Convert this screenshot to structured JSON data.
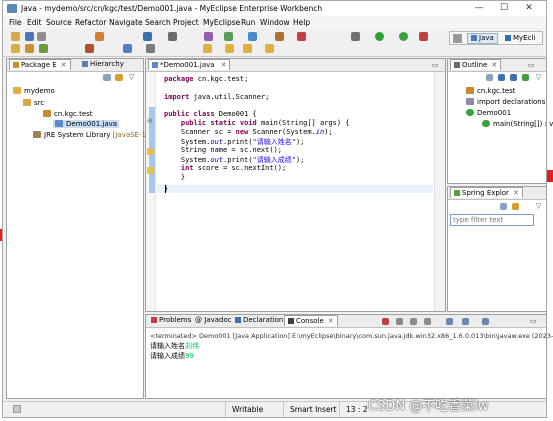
{
  "window": {
    "title": "Java - mydemo/src/cn/kgc/test/Demo001.java - MyEclipse Enterprise Workbench",
    "controls": [
      "—",
      "☐",
      "✕"
    ]
  },
  "menu": [
    "File",
    "Edit",
    "Source",
    "Refactor",
    "Navigate",
    "Search",
    "Project",
    "MyEclipse",
    "Run",
    "Window",
    "Help"
  ],
  "perspectives": {
    "java": "Java",
    "myeclipse": "MyEcli"
  },
  "package_explorer": {
    "tabs": [
      "Package E",
      "Hierarchy"
    ],
    "tree": [
      {
        "label": "mydemo",
        "level": 0,
        "icon": "project-icon"
      },
      {
        "label": "src",
        "level": 1,
        "icon": "folder-icon"
      },
      {
        "label": "cn.kgc.test",
        "level": 2,
        "icon": "package-icon"
      },
      {
        "label": "Demo001.java",
        "level": 3,
        "icon": "java-file-icon"
      }
    ],
    "jre": {
      "name": "JRE System Library",
      "version": "[JavaSE-1.6]"
    }
  },
  "editor": {
    "tab": "*Demo001.java",
    "lines": [
      [
        {
          "t": "package",
          "c": "kw"
        },
        {
          "t": " cn.kgc.test;",
          "c": ""
        }
      ],
      [],
      [
        {
          "t": "import",
          "c": "kw"
        },
        {
          "t": " java.util.Scanner;",
          "c": ""
        }
      ],
      [],
      [
        {
          "t": "public",
          "c": "kw"
        },
        {
          "t": " ",
          "c": ""
        },
        {
          "t": "class",
          "c": "kw"
        },
        {
          "t": " Demo001 {",
          "c": ""
        }
      ],
      [
        {
          "t": "    ",
          "c": ""
        },
        {
          "t": "public",
          "c": "kw"
        },
        {
          "t": " ",
          "c": ""
        },
        {
          "t": "static",
          "c": "kw"
        },
        {
          "t": " ",
          "c": ""
        },
        {
          "t": "void",
          "c": "kw"
        },
        {
          "t": " main(String[] args) {",
          "c": ""
        }
      ],
      [
        {
          "t": "    Scanner sc = ",
          "c": ""
        },
        {
          "t": "new",
          "c": "kw"
        },
        {
          "t": " Scanner(System.",
          "c": ""
        },
        {
          "t": "in",
          "c": "fld"
        },
        {
          "t": ");",
          "c": ""
        }
      ],
      [
        {
          "t": "    System.",
          "c": ""
        },
        {
          "t": "out",
          "c": "fld"
        },
        {
          "t": ".print(",
          "c": ""
        },
        {
          "t": "\"请输入姓名\"",
          "c": "str"
        },
        {
          "t": ");",
          "c": ""
        }
      ],
      [
        {
          "t": "    String name = sc.next();",
          "c": ""
        }
      ],
      [
        {
          "t": "    System.",
          "c": ""
        },
        {
          "t": "out",
          "c": "fld"
        },
        {
          "t": ".print(",
          "c": ""
        },
        {
          "t": "\"请输入成绩\"",
          "c": "str"
        },
        {
          "t": ");",
          "c": ""
        }
      ],
      [
        {
          "t": "    ",
          "c": ""
        },
        {
          "t": "int",
          "c": "kw"
        },
        {
          "t": " score = sc.nextInt();",
          "c": ""
        }
      ],
      [
        {
          "t": "    }",
          "c": ""
        }
      ],
      [
        {
          "t": "}",
          "c": ""
        }
      ]
    ]
  },
  "outline": {
    "tab": "Outline",
    "items": [
      {
        "label": "cn.kgc.test",
        "icon": "package-icon"
      },
      {
        "label": "import declarations",
        "icon": "import-icon"
      },
      {
        "label": "Demo001",
        "icon": "class-icon"
      },
      {
        "label": "main(String[]) : vo",
        "icon": "method-icon"
      }
    ]
  },
  "spring_explorer": {
    "tab": "Spring Explor",
    "filter_placeholder": "type filter text"
  },
  "bottom_tabs": [
    "Problems",
    "Javadoc",
    "Declaration",
    "Console"
  ],
  "console": {
    "header": "<terminated> Demo001 [Java Application] E:\\myEclipse\\binary\\com.sun.java.jdk.win32.x86_1.6.0.013\\bin\\javaw.exe (2023-5-27 上",
    "lines": [
      {
        "prompt": "请输入姓名",
        "input": "刘伟"
      },
      {
        "prompt": "请输入成绩",
        "input": "99"
      }
    ]
  },
  "status": {
    "mode": "Writable",
    "insert": "Smart Insert",
    "position": "13 : 2"
  },
  "watermark": "CSDN @不吃香菜lw",
  "colors": {
    "selection": "#c6dcf5",
    "keyword": "#7f0055",
    "string": "#2a00ff",
    "input": "#00c060",
    "current_line": "#e8f2fe",
    "accent_red": "#e02020"
  }
}
